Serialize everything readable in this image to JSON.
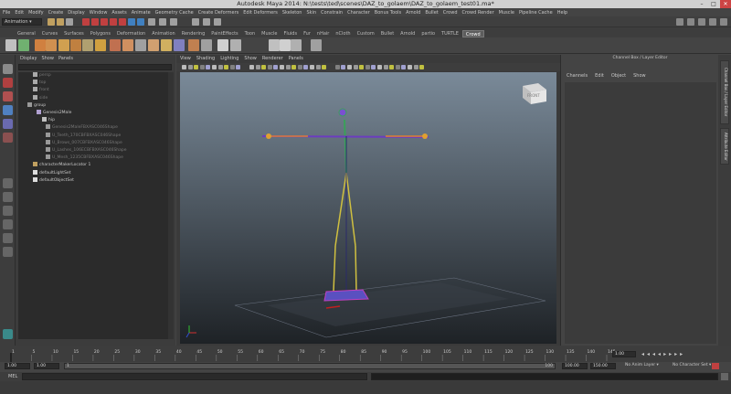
{
  "window": {
    "title": "Autodesk Maya 2014: N:\\tests\\ted\\scenes\\DAZ_to_golaem\\DAZ_to_golaem_test01.ma*"
  },
  "menu": [
    "File",
    "Edit",
    "Modify",
    "Create",
    "Display",
    "Window",
    "Assets",
    "Animate",
    "Geometry Cache",
    "Create Deformers",
    "Edit Deformers",
    "Skeleton",
    "Skin",
    "Constrain",
    "Character",
    "Bonus Tools",
    "Arnold",
    "Bullet",
    "Crowd",
    "Crowd Render",
    "Muscle",
    "Pipeline Cache",
    "Help"
  ],
  "status": {
    "mode": "Animation"
  },
  "shelf_tabs": [
    "General",
    "Curves",
    "Surfaces",
    "Polygons",
    "Deformation",
    "Animation",
    "Rendering",
    "PaintEffects",
    "Toon",
    "Muscle",
    "Fluids",
    "Fur",
    "nHair",
    "nCloth",
    "Custom",
    "Bullet",
    "Arnold",
    "partio",
    "TURTLE",
    "Crowd"
  ],
  "shelf_active": "Crowd",
  "outliner": {
    "menu": [
      "Display",
      "Show",
      "Panels"
    ],
    "rows": [
      {
        "label": "persp",
        "dim": true
      },
      {
        "label": "top",
        "dim": true
      },
      {
        "label": "front",
        "dim": true
      },
      {
        "label": "side",
        "dim": true
      },
      {
        "label": "group",
        "dim": false
      },
      {
        "label": "Genesis2Male",
        "dim": false
      },
      {
        "label": "hip",
        "dim": false
      },
      {
        "label": "Genesis2MaleFBXASC046Shape",
        "dim": true
      },
      {
        "label": "U_Teeth_170CBFBXASC046Shape",
        "dim": true
      },
      {
        "label": "U_Brows_007CBFBXASC046Shape",
        "dim": true
      },
      {
        "label": "U_Lashes_106ECBFBXASC046Shape",
        "dim": true
      },
      {
        "label": "U_Mesh_1235CBFBXASC046Shape",
        "dim": true
      },
      {
        "label": "characterMakerLocator 1",
        "dim": false
      },
      {
        "label": "defaultLightSet",
        "dim": false
      },
      {
        "label": "defaultObjectSet",
        "dim": false
      }
    ]
  },
  "viewport": {
    "menu": [
      "View",
      "Shading",
      "Lighting",
      "Show",
      "Renderer",
      "Panels"
    ],
    "viewcube_label": "FRONT"
  },
  "channel_box": {
    "title": "Channel Box / Layer Editor",
    "menu": [
      "Channels",
      "Edit",
      "Object",
      "Show"
    ]
  },
  "side_tabs": [
    "Channel Box / Layer Editor",
    "Attribute Editor"
  ],
  "timeline": {
    "ticks": [
      "1",
      "5",
      "10",
      "15",
      "20",
      "25",
      "30",
      "35",
      "40",
      "45",
      "50",
      "55",
      "60",
      "65",
      "70",
      "75",
      "80",
      "85",
      "90",
      "95",
      "100",
      "105",
      "110",
      "115",
      "120",
      "125",
      "130",
      "135",
      "140",
      "145"
    ],
    "current_frame": "1.00"
  },
  "range": {
    "start": "1.00",
    "playback_start": "1.00",
    "slider_start": "1",
    "slider_end": "100",
    "playback_end": "100.00",
    "end": "150.00",
    "anim_layer": "No Anim Layer",
    "char_set": "No Character Set"
  },
  "command": {
    "label": "MEL"
  },
  "colors": {
    "viewport_top": "#7a8a99",
    "viewport_bottom": "#1e2226",
    "shelf_active": "#5d5d5d"
  }
}
